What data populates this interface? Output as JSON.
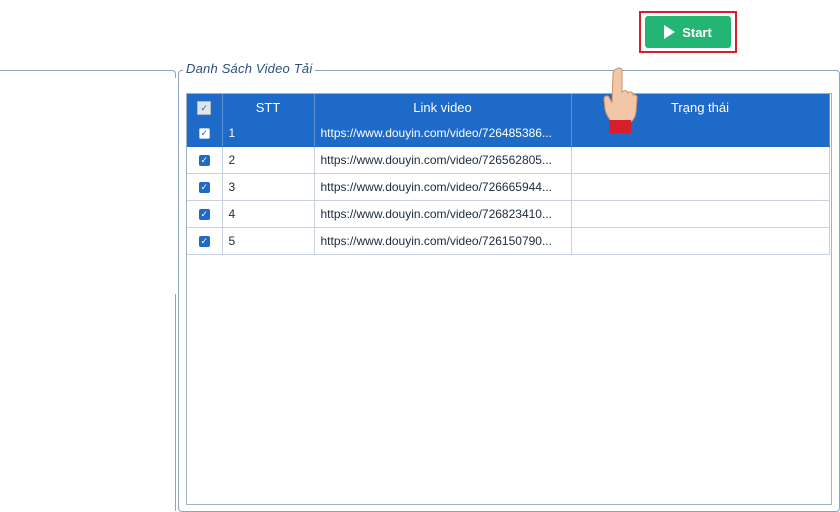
{
  "group": {
    "legend": "Danh Sách Video Tải"
  },
  "start_button": {
    "label": "Start"
  },
  "grid": {
    "columns": {
      "stt": "STT",
      "link": "Link video",
      "status": "Trạng thái"
    },
    "rows": [
      {
        "stt": "1",
        "link": "https://www.douyin.com/video/726485386...",
        "status": "",
        "checked": true,
        "selected": true
      },
      {
        "stt": "2",
        "link": "https://www.douyin.com/video/726562805...",
        "status": "",
        "checked": true
      },
      {
        "stt": "3",
        "link": "https://www.douyin.com/video/726665944...",
        "status": "",
        "checked": true
      },
      {
        "stt": "4",
        "link": "https://www.douyin.com/video/726823410...",
        "status": "",
        "checked": true
      },
      {
        "stt": "5",
        "link": "https://www.douyin.com/video/726150790...",
        "status": "",
        "checked": true
      }
    ]
  },
  "icons": {
    "play": "play-icon",
    "hand": "pointing-hand-icon",
    "check": "checkbox-checked-icon"
  },
  "colors": {
    "accent": "#1e6ac8",
    "start": "#22b573",
    "highlight": "#d81e2a"
  }
}
